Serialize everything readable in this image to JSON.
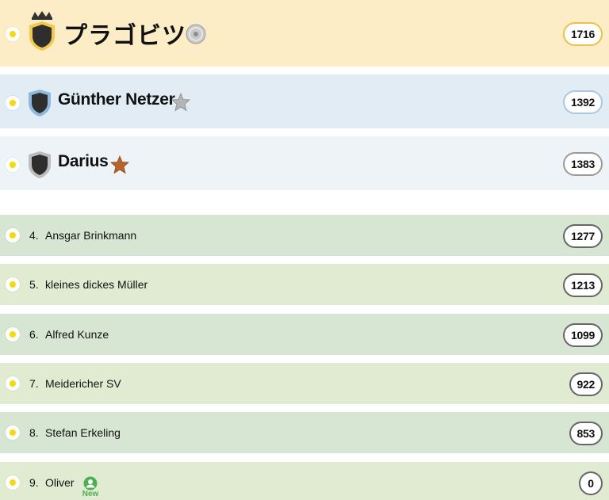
{
  "top": [
    {
      "name": "プラゴビツ",
      "score": "1716",
      "badge_icon": "disc-icon",
      "shield": "crown-shield-icon"
    },
    {
      "name": "Günther Netzer",
      "score": "1392",
      "badge_icon": "silver-star-icon",
      "shield": "shield-icon"
    },
    {
      "name": "Darius",
      "score": "1383",
      "badge_icon": "bronze-star-icon",
      "shield": "shield-icon"
    }
  ],
  "rows": [
    {
      "rank": "4.",
      "name": "Ansgar Brinkmann",
      "score": "1277"
    },
    {
      "rank": "5.",
      "name": "kleines dickes Müller",
      "score": "1213"
    },
    {
      "rank": "6.",
      "name": "Alfred Kunze",
      "score": "1099"
    },
    {
      "rank": "7.",
      "name": "Meidericher SV",
      "score": "922"
    },
    {
      "rank": "8.",
      "name": "Stefan Erkeling",
      "score": "853"
    },
    {
      "rank": "9.",
      "name": "Oliver",
      "score": "0",
      "new_label": "New"
    }
  ],
  "colors": {
    "gold_row": "#fdedc6",
    "silver_row": "#e1ecf5",
    "bronze_row": "#eef3f8",
    "green_row_a": "#d7e6d2",
    "green_row_b": "#e0ebd2",
    "status_dot": "#f5d90a",
    "new_green": "#4caf50"
  }
}
